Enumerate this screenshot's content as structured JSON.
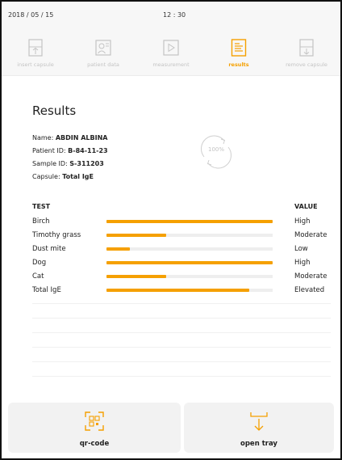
{
  "status_bar": {
    "date": "2018 / 05 / 15",
    "time": "12 : 30"
  },
  "steps": [
    {
      "label": "insert capsule",
      "icon": "insert-capsule-icon"
    },
    {
      "label": "patient data",
      "icon": "patient-data-icon"
    },
    {
      "label": "measurement",
      "icon": "play-icon"
    },
    {
      "label": "results",
      "icon": "results-icon",
      "active": true
    },
    {
      "label": "remove capsule",
      "icon": "remove-capsule-icon"
    }
  ],
  "main": {
    "title": "Results",
    "info": [
      {
        "label": "Name: ",
        "value": "ABDIN ALBINA"
      },
      {
        "label": "Patient ID: ",
        "value": "B-84-11-23"
      },
      {
        "label": "Sample ID: ",
        "value": "S-311203"
      },
      {
        "label": "Capsule: ",
        "value": "Total IgE"
      }
    ],
    "progress": "100%",
    "table": {
      "headers": {
        "test": "TEST",
        "value": "VALUE"
      },
      "rows": [
        {
          "test": "Birch",
          "level": 1.0,
          "value": "High"
        },
        {
          "test": "Timothy grass",
          "level": 0.36,
          "value": "Moderate"
        },
        {
          "test": "Dust mite",
          "level": 0.14,
          "value": "Low"
        },
        {
          "test": "Dog",
          "level": 1.0,
          "value": "High"
        },
        {
          "test": "Cat",
          "level": 0.36,
          "value": "Moderate"
        },
        {
          "test": "Total IgE",
          "level": 0.86,
          "value": "Elevated"
        }
      ]
    }
  },
  "actions": {
    "qr_code": "qr-code",
    "open_tray": "open tray"
  },
  "colors": {
    "accent": "#f5a000",
    "inactive": "#c4c4c4",
    "background": "#f7f7f7"
  }
}
